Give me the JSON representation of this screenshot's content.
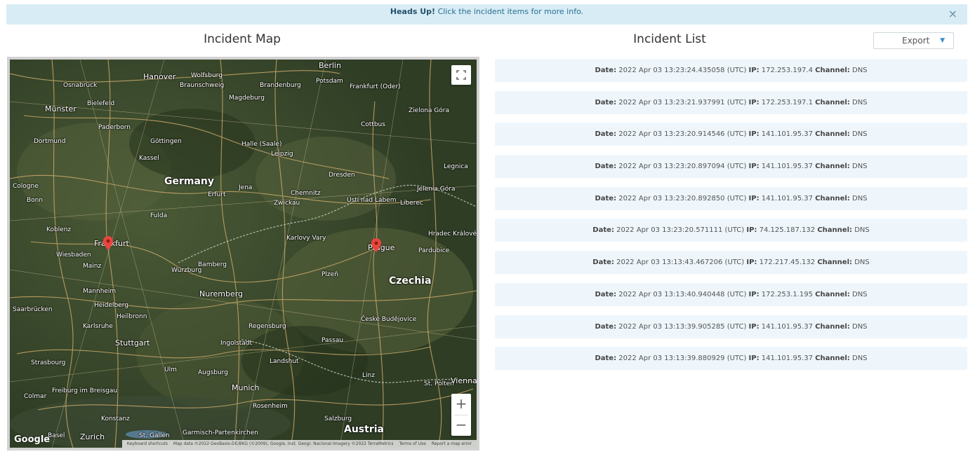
{
  "alert": {
    "heading": "Heads Up!",
    "message": "Click the incident items for more info.",
    "close_icon": "×"
  },
  "map_section": {
    "title": "Incident Map",
    "google_logo": "Google",
    "footer": {
      "shortcuts": "Keyboard shortcuts",
      "data": "Map data ©2022 GeoBasis-DE/BKG (©2009), Google, Inst. Geogr. Nacional Imagery ©2022 TerraMetrics",
      "terms": "Terms of Use",
      "report": "Report a map error"
    },
    "zoom_in": "+",
    "zoom_out": "−",
    "cities": [
      {
        "name": "Berlin",
        "cls": "mid"
      },
      {
        "name": "Hanover",
        "cls": "mid"
      },
      {
        "name": "Wolfsburg",
        "cls": ""
      },
      {
        "name": "Potsdam",
        "cls": ""
      },
      {
        "name": "Brandenburg",
        "cls": ""
      },
      {
        "name": "Frankfurt (Oder)",
        "cls": ""
      },
      {
        "name": "Osnabrück",
        "cls": ""
      },
      {
        "name": "Braunschweig",
        "cls": ""
      },
      {
        "name": "Magdeburg",
        "cls": ""
      },
      {
        "name": "Münster",
        "cls": "mid"
      },
      {
        "name": "Bielefeld",
        "cls": ""
      },
      {
        "name": "Zielona Góra",
        "cls": ""
      },
      {
        "name": "Paderborn",
        "cls": ""
      },
      {
        "name": "Cottbus",
        "cls": ""
      },
      {
        "name": "Dortmund",
        "cls": ""
      },
      {
        "name": "Göttingen",
        "cls": ""
      },
      {
        "name": "Halle (Saale)",
        "cls": ""
      },
      {
        "name": "Leipzig",
        "cls": ""
      },
      {
        "name": "Kassel",
        "cls": ""
      },
      {
        "name": "Dresden",
        "cls": ""
      },
      {
        "name": "Legnica",
        "cls": ""
      },
      {
        "name": "Germany",
        "cls": "big"
      },
      {
        "name": "Erfurt",
        "cls": ""
      },
      {
        "name": "Jena",
        "cls": ""
      },
      {
        "name": "Chemnitz",
        "cls": ""
      },
      {
        "name": "Cologne",
        "cls": ""
      },
      {
        "name": "Zwickau",
        "cls": ""
      },
      {
        "name": "Ústí nad Labem",
        "cls": ""
      },
      {
        "name": "Liberec",
        "cls": ""
      },
      {
        "name": "Jelenia Góra",
        "cls": ""
      },
      {
        "name": "Bonn",
        "cls": ""
      },
      {
        "name": "Fulda",
        "cls": ""
      },
      {
        "name": "Koblenz",
        "cls": ""
      },
      {
        "name": "Karlovy Vary",
        "cls": ""
      },
      {
        "name": "Hradec Králové",
        "cls": ""
      },
      {
        "name": "Frankfurt",
        "cls": "mid"
      },
      {
        "name": "Prague",
        "cls": "mid"
      },
      {
        "name": "Wiesbaden",
        "cls": ""
      },
      {
        "name": "Mainz",
        "cls": ""
      },
      {
        "name": "Würzburg",
        "cls": ""
      },
      {
        "name": "Bamberg",
        "cls": ""
      },
      {
        "name": "Pardubice",
        "cls": ""
      },
      {
        "name": "Plzeň",
        "cls": ""
      },
      {
        "name": "Czechia",
        "cls": "big"
      },
      {
        "name": "Mannheim",
        "cls": ""
      },
      {
        "name": "Nuremberg",
        "cls": "mid"
      },
      {
        "name": "Saarbrücken",
        "cls": ""
      },
      {
        "name": "Heidelberg",
        "cls": ""
      },
      {
        "name": "Heilbronn",
        "cls": ""
      },
      {
        "name": "Regensburg",
        "cls": ""
      },
      {
        "name": "České Budějovice",
        "cls": ""
      },
      {
        "name": "Karlsruhe",
        "cls": ""
      },
      {
        "name": "Ingolstadt",
        "cls": ""
      },
      {
        "name": "Stuttgart",
        "cls": "mid"
      },
      {
        "name": "Passau",
        "cls": ""
      },
      {
        "name": "Strasbourg",
        "cls": ""
      },
      {
        "name": "Ulm",
        "cls": ""
      },
      {
        "name": "Augsburg",
        "cls": ""
      },
      {
        "name": "Landshut",
        "cls": ""
      },
      {
        "name": "Linz",
        "cls": ""
      },
      {
        "name": "St. Pölten",
        "cls": ""
      },
      {
        "name": "Freiburg im Breisgau",
        "cls": ""
      },
      {
        "name": "Munich",
        "cls": "mid"
      },
      {
        "name": "Colmar",
        "cls": ""
      },
      {
        "name": "Rosenheim",
        "cls": ""
      },
      {
        "name": "Salzburg",
        "cls": ""
      },
      {
        "name": "Konstanz",
        "cls": ""
      },
      {
        "name": "Austria",
        "cls": "big"
      },
      {
        "name": "Zurich",
        "cls": "mid"
      },
      {
        "name": "Basel",
        "cls": ""
      },
      {
        "name": "St. Gallen",
        "cls": ""
      },
      {
        "name": "Garmisch-Partenkirchen",
        "cls": ""
      },
      {
        "name": "Vienna",
        "cls": "mid"
      }
    ]
  },
  "list_section": {
    "title": "Incident List",
    "export_label": "Export",
    "export_caret": "▼",
    "label_date": "Date:",
    "label_ip": "IP:",
    "label_channel": "Channel:",
    "incidents": [
      {
        "date": "2022 Apr 03 13:23:24.435058 (UTC)",
        "ip": "172.253.197.4",
        "channel": "DNS"
      },
      {
        "date": "2022 Apr 03 13:23:21.937991 (UTC)",
        "ip": "172.253.197.1",
        "channel": "DNS"
      },
      {
        "date": "2022 Apr 03 13:23:20.914546 (UTC)",
        "ip": "141.101.95.37",
        "channel": "DNS"
      },
      {
        "date": "2022 Apr 03 13:23:20.897094 (UTC)",
        "ip": "141.101.95.37",
        "channel": "DNS"
      },
      {
        "date": "2022 Apr 03 13:23:20.892850 (UTC)",
        "ip": "141.101.95.37",
        "channel": "DNS"
      },
      {
        "date": "2022 Apr 03 13:23:20.571111 (UTC)",
        "ip": "74.125.187.132",
        "channel": "DNS"
      },
      {
        "date": "2022 Apr 03 13:13:43.467206 (UTC)",
        "ip": "172.217.45.132",
        "channel": "DNS"
      },
      {
        "date": "2022 Apr 03 13:13:40.940448 (UTC)",
        "ip": "172.253.1.195",
        "channel": "DNS"
      },
      {
        "date": "2022 Apr 03 13:13:39.905285 (UTC)",
        "ip": "141.101.95.37",
        "channel": "DNS"
      },
      {
        "date": "2022 Apr 03 13:13:39.880929 (UTC)",
        "ip": "141.101.95.37",
        "channel": "DNS"
      }
    ]
  },
  "colors": {
    "alert_bg": "#d7ecf5",
    "item_bg": "#eef6fc",
    "pin": "#e8453c",
    "export_caret": "#3a8fc9"
  }
}
